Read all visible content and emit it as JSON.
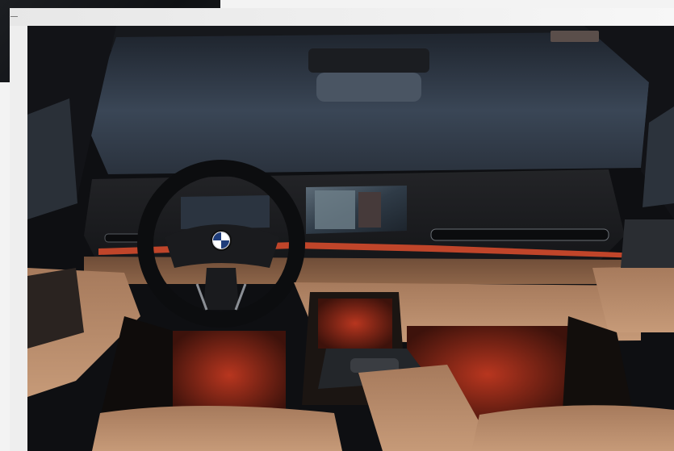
{
  "image": {
    "subject": "car-interior",
    "brand_logo": "bmw-roundel-icon",
    "colors": {
      "windshield": "#2f3a48",
      "dashboard": "#1a1b1e",
      "leather": "#b98d6e",
      "ambient": "#d24a2a",
      "frame": "#eeeeee"
    }
  }
}
